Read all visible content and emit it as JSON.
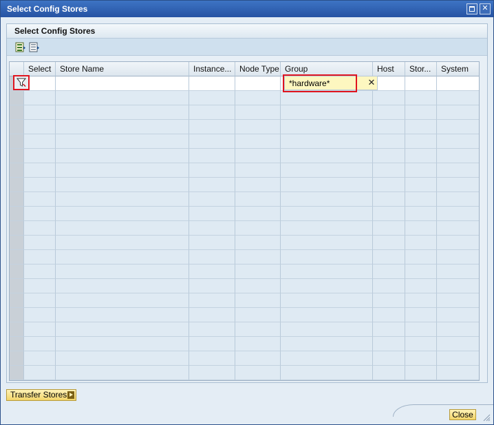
{
  "window": {
    "title": "Select Config Stores",
    "maximize_icon": "maximize-icon",
    "close_icon": "close-icon",
    "close_glyph": "✕"
  },
  "panel": {
    "title": "Select Config Stores",
    "toolbar": {
      "buttons": [
        {
          "icon": "select-all-icon"
        },
        {
          "icon": "deselect-all-icon"
        }
      ]
    }
  },
  "table": {
    "columns": [
      "",
      "Select",
      "Store Name",
      "Instance...",
      "Node Type",
      "Group",
      "Host",
      "Stor...",
      "System"
    ],
    "filter": {
      "icon": "filter-icon",
      "group_value": "*hardware*",
      "clear_glyph": "✕"
    },
    "empty_rows": 20
  },
  "actions": {
    "transfer_label": "Transfer Stores",
    "close_label": "Close"
  },
  "colors": {
    "titlebar": "#2f5fb0",
    "highlight": "#e0141e",
    "button": "#f2d56a"
  }
}
